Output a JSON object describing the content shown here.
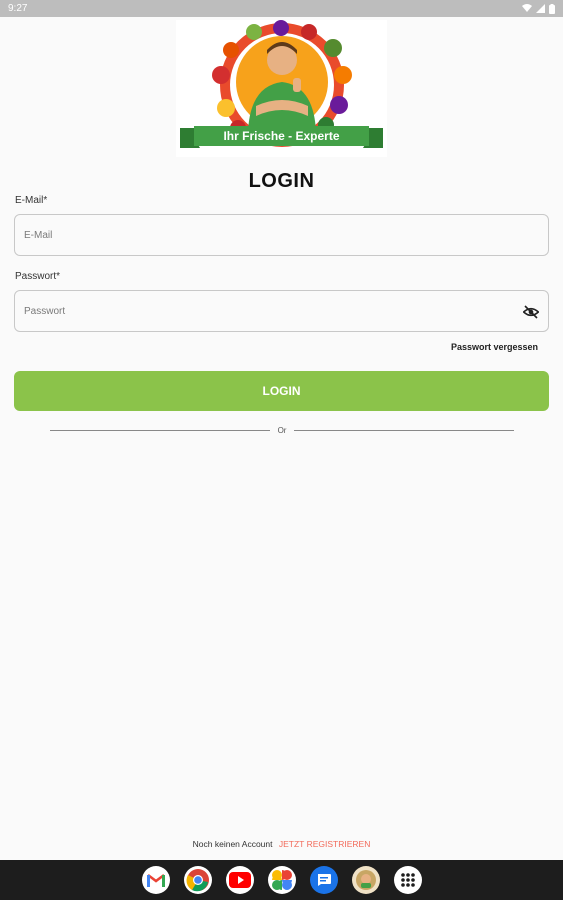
{
  "status_bar": {
    "time": "9:27"
  },
  "logo": {
    "banner_text": "Ihr Frische - Experte"
  },
  "login": {
    "title": "LOGIN",
    "email_label": "E-Mail*",
    "email_placeholder": "E-Mail",
    "password_label": "Passwort*",
    "password_placeholder": "Passwort",
    "forgot_password": "Passwort vergessen",
    "login_button": "LOGIN",
    "divider_text": "Or"
  },
  "register": {
    "prompt": "Noch keinen Account",
    "link": "JETZT REGISTRIEREN"
  },
  "colors": {
    "accent_green": "#8bc34a",
    "register_link": "#f26b5b"
  },
  "taskbar": {
    "apps": [
      "gmail-icon",
      "chrome-icon",
      "youtube-icon",
      "photos-icon",
      "messages-icon",
      "app-icon",
      "app-drawer-icon"
    ]
  }
}
